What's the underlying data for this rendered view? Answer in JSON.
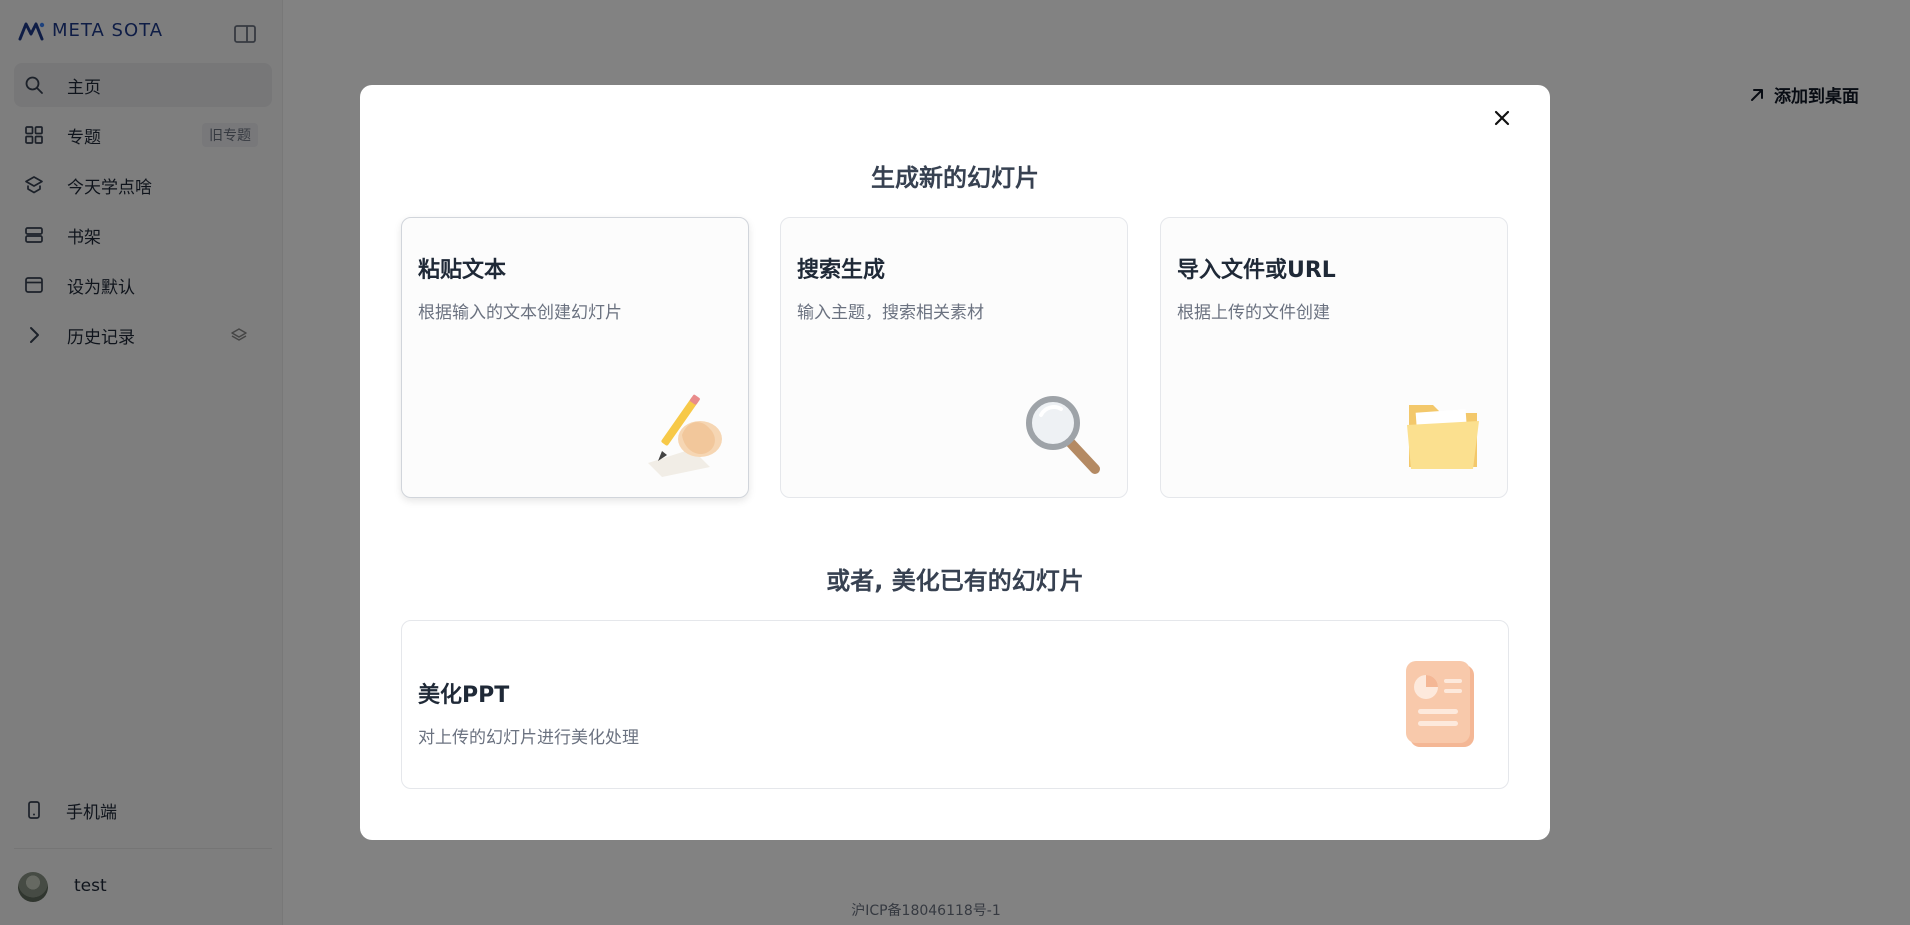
{
  "brand": {
    "name": "META SOTA"
  },
  "sidebar": {
    "items": [
      {
        "label": "主页",
        "icon": "search-icon",
        "active": true
      },
      {
        "label": "专题",
        "icon": "grid-icon",
        "badge": "旧专题"
      },
      {
        "label": "今天学点啥",
        "icon": "layers-icon"
      },
      {
        "label": "书架",
        "icon": "bookshelf-icon"
      },
      {
        "label": "设为默认",
        "icon": "window-icon"
      },
      {
        "label": "历史记录",
        "icon": "chevron-right-icon"
      }
    ],
    "mobile": {
      "label": "手机端",
      "icon": "phone-icon"
    },
    "user": {
      "name": "test"
    }
  },
  "header": {
    "add_desktop_label": "添加到桌面"
  },
  "footer": {
    "icp": "沪ICP备18046118号-1"
  },
  "modal": {
    "title_new": "生成新的幻灯片",
    "title_beautify": "或者, 美化已有的幻灯片",
    "cards": [
      {
        "title": "粘贴文本",
        "desc": "根据输入的文本创建幻灯片",
        "icon": "writing-hand-icon"
      },
      {
        "title": "搜索生成",
        "desc": "输入主题，搜索相关素材",
        "icon": "magnifier-icon"
      },
      {
        "title": "导入文件或URL",
        "desc": "根据上传的文件创建",
        "icon": "folder-icon"
      }
    ],
    "beautify": {
      "title": "美化PPT",
      "desc": "对上传的幻灯片进行美化处理",
      "icon": "ppt-document-icon"
    }
  },
  "colors": {
    "overlay": "#000000",
    "brand": "#1e3a8a"
  }
}
